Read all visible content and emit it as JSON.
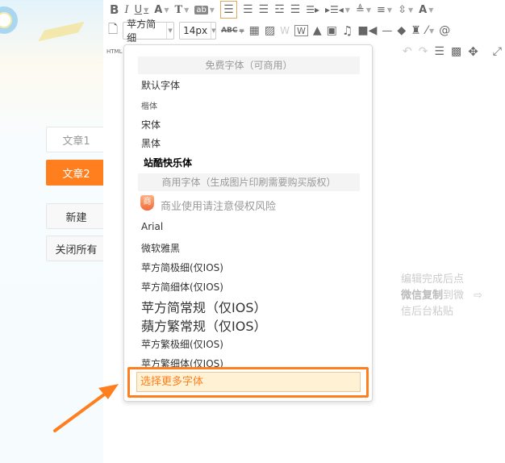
{
  "sidebar": {
    "tabs": [
      {
        "label": "文章1",
        "active": false
      },
      {
        "label": "文章2",
        "active": true
      }
    ],
    "new_label": "新建",
    "close_all_label": "关闭所有"
  },
  "toolbar": {
    "font_family": "苹方简细",
    "font_size": "14px",
    "html_label": "HTML",
    "accent_color": "#ff7f1f"
  },
  "font_dropdown": {
    "free_header": "免费字体（可商用）",
    "free_fonts": [
      "默认字体",
      "楷体",
      "宋体",
      "黑体",
      "站酷快乐体"
    ],
    "commercial_header": "商用字体（生成图片印刷需要购买版权）",
    "warning_badge": "商",
    "warning_text": "商业使用请注意侵权风险",
    "commercial_fonts": [
      "Arial",
      "微软雅黑",
      "苹方简极细(仅IOS)",
      "苹方简细体(仅IOS)",
      "苹方简常规（仅IOS）",
      "蘋方繁常规（仅IOS）",
      "苹方繁极细(仅IOS)",
      "苹方繁细体(仅IOS)"
    ],
    "more_fonts": "选择更多字体"
  },
  "hint": {
    "line1": "编辑完成后点",
    "bold": "微信复制",
    "line2_rest": "到微",
    "line3": "信后台粘贴"
  }
}
